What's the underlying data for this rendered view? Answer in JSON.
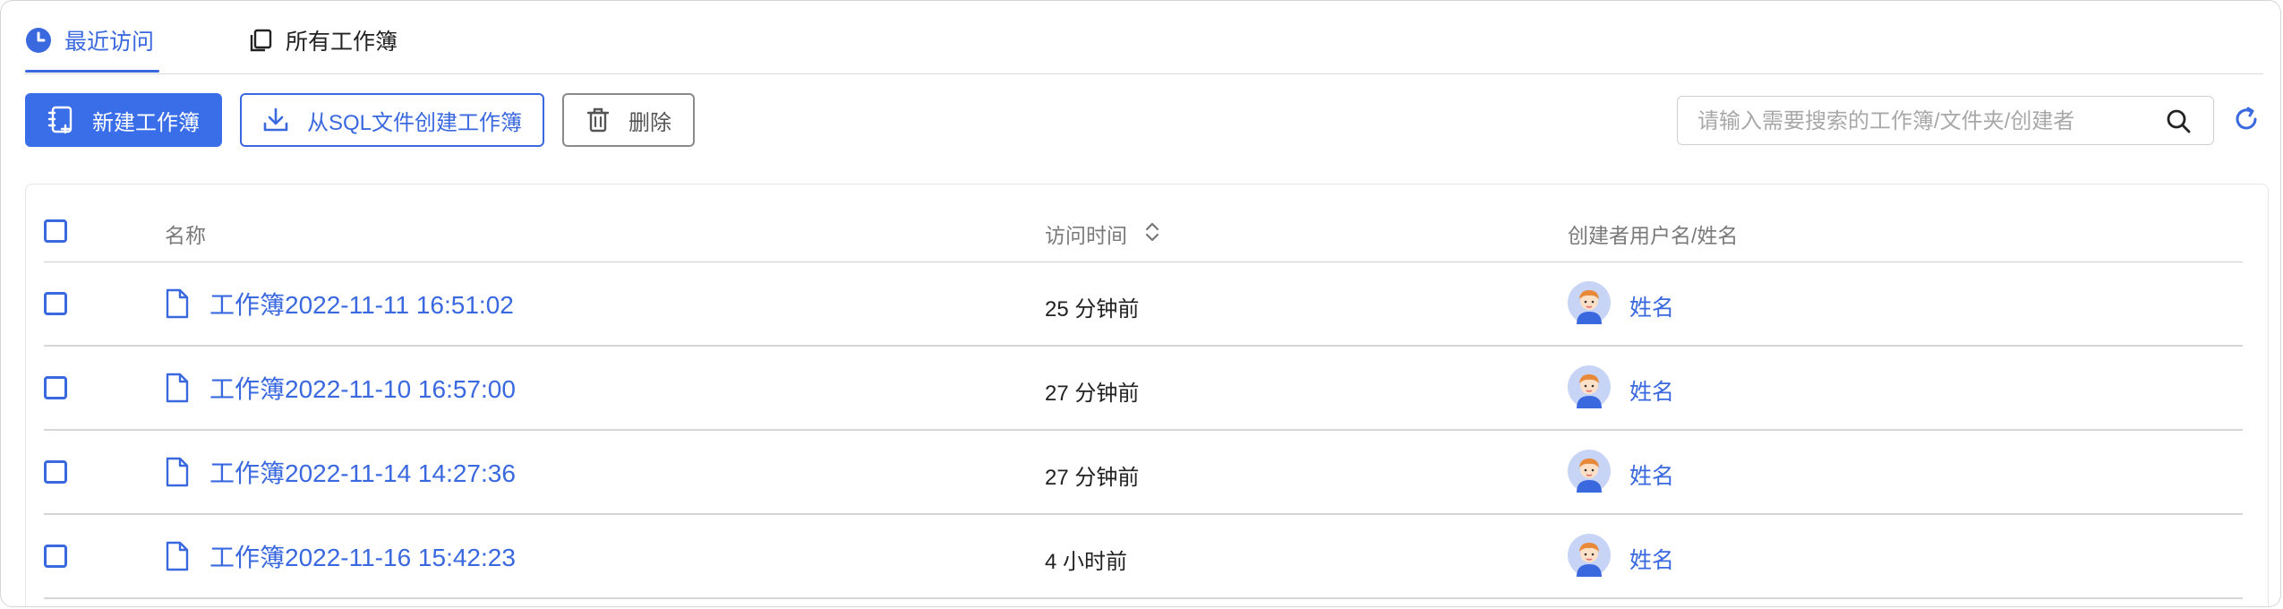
{
  "tabs": [
    {
      "label": "最近访问",
      "icon": "clock-icon",
      "active": true
    },
    {
      "label": "所有工作簿",
      "icon": "workbooks-icon",
      "active": false
    }
  ],
  "toolbar": {
    "new_label": "新建工作簿",
    "sql_label": "从SQL文件创建工作簿",
    "delete_label": "删除"
  },
  "search": {
    "placeholder": "请输入需要搜索的工作簿/文件夹/创建者",
    "value": ""
  },
  "table": {
    "headers": {
      "name": "名称",
      "time": "访问时间",
      "creator": "创建者用户名/姓名"
    },
    "rows": [
      {
        "name": "工作簿2022-11-11 16:51:02",
        "time": "25 分钟前",
        "creator": "姓名"
      },
      {
        "name": "工作簿2022-11-10 16:57:00",
        "time": "27 分钟前",
        "creator": "姓名"
      },
      {
        "name": "工作簿2022-11-14 14:27:36",
        "time": "27 分钟前",
        "creator": "姓名"
      },
      {
        "name": "工作簿2022-11-16 15:42:23",
        "time": "4 小时前",
        "creator": "姓名"
      }
    ]
  },
  "colors": {
    "accent": "#3a68df",
    "primary_button": "#3a6ee8",
    "divider": "#d6d6d6"
  }
}
